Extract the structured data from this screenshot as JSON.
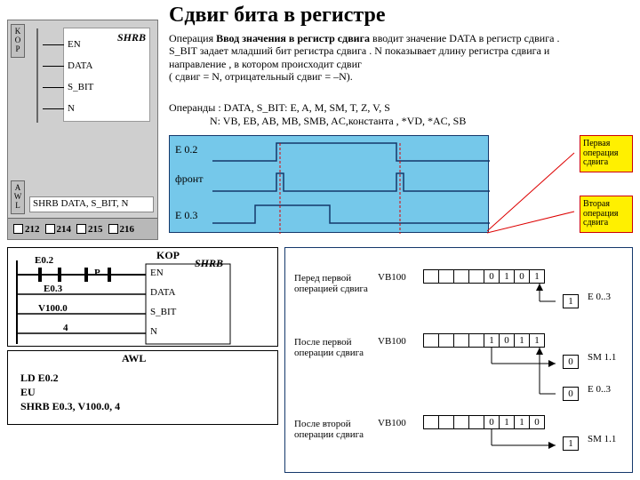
{
  "title": "Сдвиг бита в регистре",
  "ide": {
    "tab_kop": "K\nO\nP",
    "tab_awl": "A\nW\nL",
    "block_name": "SHRB",
    "pins": [
      "EN",
      "DATA",
      "S_BIT",
      "N"
    ],
    "awl_line": "SHRB DATA, S_BIT, N",
    "pages": [
      "212",
      "214",
      "215",
      "216"
    ]
  },
  "description": {
    "p1a": "Операция ",
    "p1b": "Ввод значения в регистр сдвига",
    "p1c": " вводит значение DATA в регистр сдвига . S_BIT задает младший бит регистра сдвига . N показывает длину регистра сдвига и направление , в котором происходит сдвиг",
    "p1d": "( сдвиг = N, отрицательный сдвиг = –N).",
    "operands_l1": "Операнды : DATA, S_BIT: E, A, M, SM, T, Z, V, S",
    "operands_l2": "N: VB, EB, AB, MB, SMB, AC,константа , *VD, *AC, SB"
  },
  "timing": {
    "sig1": "E 0.2",
    "sig2": "фронт",
    "sig3": "E 0.3"
  },
  "callouts": {
    "first": "Первая операция сдвига",
    "second": "Вторая операция сдвига"
  },
  "kop": {
    "header": "KOP",
    "e02": "E0.2",
    "p": "P",
    "en": "EN",
    "shrb": "SHRB",
    "e03": "E0.3",
    "data": "DATA",
    "v100": "V100.0",
    "sbit": "S_BIT",
    "four": "4",
    "n": "N"
  },
  "awl": {
    "header": "AWL",
    "l1": "LD   E0.2",
    "l2": "EU",
    "l3": "SHRB   E0.3, V100.0, 4"
  },
  "regs": {
    "row1": {
      "label": "Перед первой операцией сдвига",
      "vb": "VB100",
      "bits": [
        "",
        "",
        "",
        "",
        "0",
        "1",
        "0",
        "1"
      ],
      "in": "1",
      "inlabel": "E 0..3"
    },
    "row2": {
      "label": "После  первой операции сдвига",
      "vb": "VB100",
      "bits": [
        "",
        "",
        "",
        "",
        "1",
        "0",
        "1",
        "1"
      ],
      "out": "0",
      "outlabel": "SM 1.1",
      "in": "0",
      "inlabel": "E 0..3"
    },
    "row3": {
      "label": "После второй операции сдвига",
      "vb": "VB100",
      "bits": [
        "",
        "",
        "",
        "",
        "0",
        "1",
        "1",
        "0"
      ],
      "out": "1",
      "outlabel": "SM 1.1"
    }
  }
}
